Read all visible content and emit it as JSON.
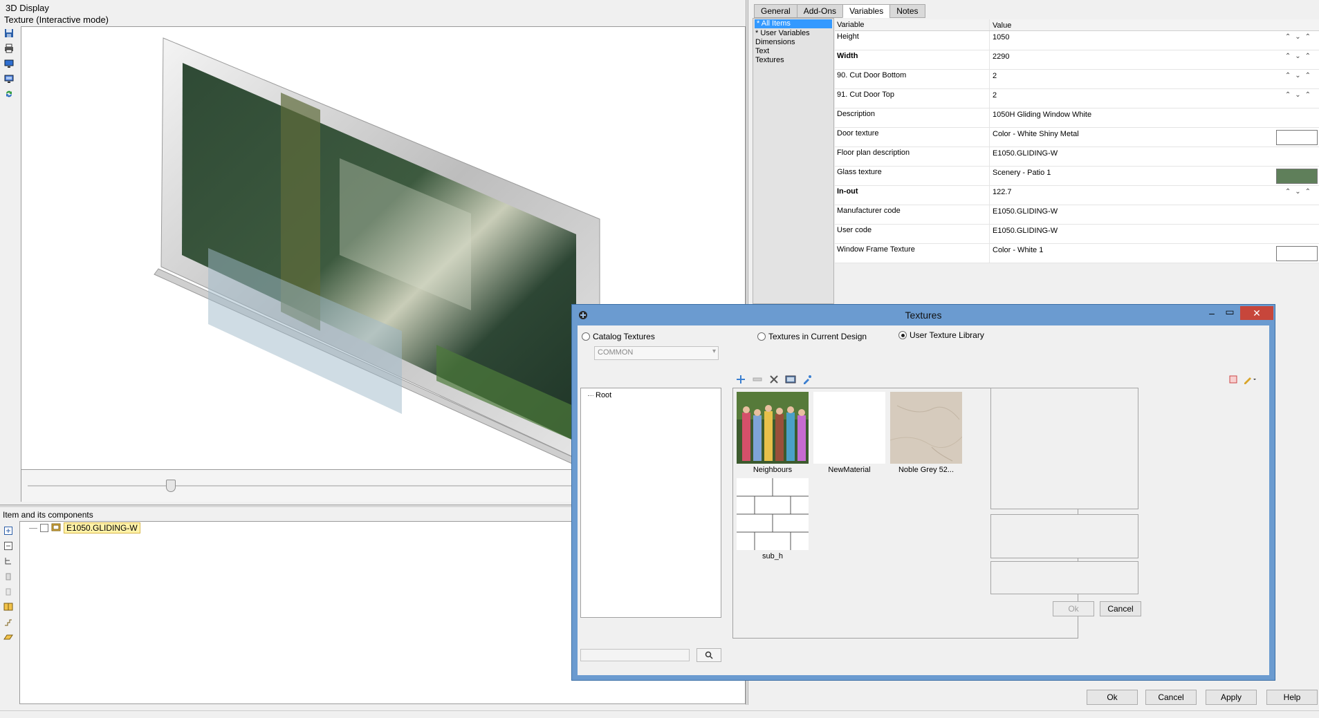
{
  "display": {
    "title": "3D Display",
    "mode": "Texture (Interactive mode)"
  },
  "components": {
    "title": "Item and its components",
    "node_label": "E1050.GLIDING-W"
  },
  "tabs": [
    {
      "label": "General"
    },
    {
      "label": "Add-Ons"
    },
    {
      "label": "Variables"
    },
    {
      "label": "Notes"
    }
  ],
  "categories": [
    {
      "label": "* All Items"
    },
    {
      "label": "* User Variables"
    },
    {
      "label": "Dimensions"
    },
    {
      "label": "Text"
    },
    {
      "label": "Textures"
    }
  ],
  "table": {
    "header_variable": "Variable",
    "header_value": "Value",
    "rows": [
      {
        "variable": "Height",
        "value": "1050"
      },
      {
        "variable": "Width",
        "value": "2290"
      },
      {
        "variable": "90. Cut Door Bottom",
        "value": "2"
      },
      {
        "variable": "91. Cut Door Top",
        "value": "2"
      },
      {
        "variable": "Description",
        "value": "1050H Gliding Window White"
      },
      {
        "variable": "Door texture",
        "value": "Color - White Shiny Metal"
      },
      {
        "variable": "Floor plan description",
        "value": "E1050.GLIDING-W"
      },
      {
        "variable": "Glass texture",
        "value": "Scenery - Patio 1"
      },
      {
        "variable": "In-out",
        "value": "122.7"
      },
      {
        "variable": "Manufacturer code",
        "value": "E1050.GLIDING-W"
      },
      {
        "variable": "User code",
        "value": "E1050.GLIDING-W"
      },
      {
        "variable": "Window Frame Texture",
        "value": "Color - White 1"
      }
    ]
  },
  "swatch_colors": {
    "white": "#ffffff",
    "glass_green": "#5f7f5a"
  },
  "buttons": {
    "ok": "Ok",
    "cancel": "Cancel",
    "apply": "Apply",
    "help": "Help"
  },
  "dialog": {
    "title": "Textures",
    "radio_catalog": "Catalog Textures",
    "radio_current": "Textures in Current Design",
    "radio_user": "User Texture Library",
    "selected_source": "User Texture Library",
    "combo_value": "COMMON",
    "tree_root": "Root",
    "textures": [
      {
        "name": "Neighbours"
      },
      {
        "name": "NewMaterial"
      },
      {
        "name": "Noble Grey 52..."
      },
      {
        "name": "sub_h"
      }
    ],
    "ok": "Ok",
    "cancel": "Cancel"
  },
  "icons": [
    "save-icon",
    "print-icon",
    "monitor-icon",
    "render-icon",
    "refresh-icon",
    "add-icon",
    "remove-icon",
    "delete-icon",
    "import-icon",
    "eyedropper-icon",
    "search-icon"
  ]
}
